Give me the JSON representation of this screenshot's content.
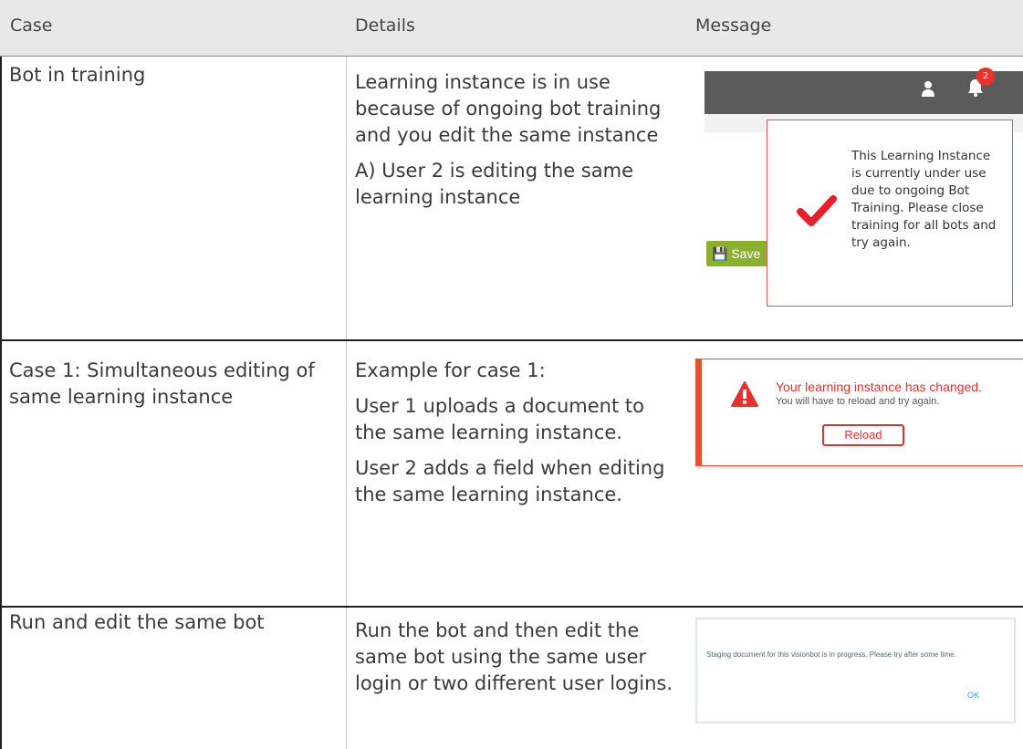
{
  "header": {
    "col_case": "Case",
    "col_details": "Details",
    "col_message": "Message"
  },
  "rows": [
    {
      "case": "Bot in training",
      "details": [
        "Learning instance is in use because of ongoing bot training and you edit the same instance",
        "A) User 2 is editing the same learning instance"
      ],
      "message": {
        "badge_count": "2",
        "save_label": "Save",
        "modal_text": "This Learning Instance is currently under use due to ongoing Bot Training. Please close training for all bots and try again.",
        "accent_color": "#e6342a"
      }
    },
    {
      "case": "Case 1: Simultaneous editing of same learning instance",
      "details": [
        "Example for case 1:",
        "User 1 uploads a document to the same learning instance.",
        "User 2 adds a field when editing the same learning instance."
      ],
      "message": {
        "title": "Your learning instance has changed.",
        "subtitle": "You will have to reload and try again.",
        "button": "Reload",
        "accent_color": "#e5312b"
      }
    },
    {
      "case": "Run and edit the same bot",
      "details": [
        "Run the bot and then edit the same bot using the same user login or two different user logins."
      ],
      "message": {
        "text": "Staging document for this visionbot is in progress. Please try after some time.",
        "button": "OK",
        "accent_color": "#2f9fd6"
      }
    }
  ]
}
